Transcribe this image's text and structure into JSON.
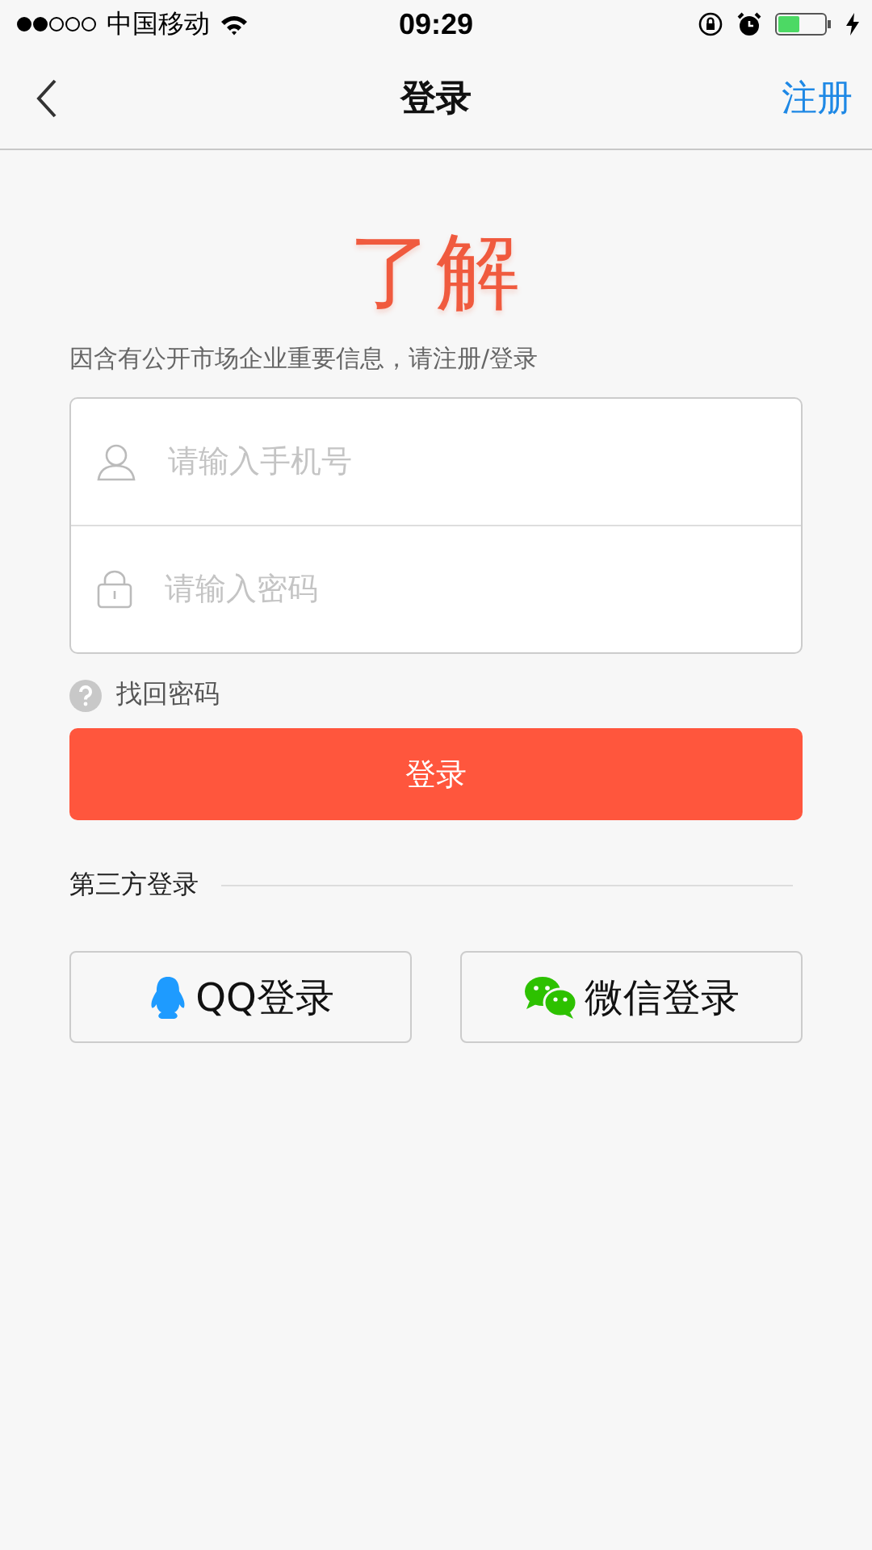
{
  "status_bar": {
    "carrier": "中国移动",
    "time": "09:29"
  },
  "nav_bar": {
    "title": "登录",
    "action": "注册"
  },
  "logo": "了解",
  "notice": "因含有公开市场企业重要信息，请注册/登录",
  "fields": [
    {
      "kind": "phone",
      "placeholder": "请输入手机号"
    },
    {
      "kind": "password",
      "placeholder": "请输入密码"
    }
  ],
  "forgot_password": "找回密码",
  "login_button": "登录",
  "third_party": {
    "label": "第三方登录",
    "buttons": [
      {
        "kind": "qq",
        "label": "QQ登录"
      },
      {
        "kind": "wechat",
        "label": "微信登录"
      }
    ]
  }
}
